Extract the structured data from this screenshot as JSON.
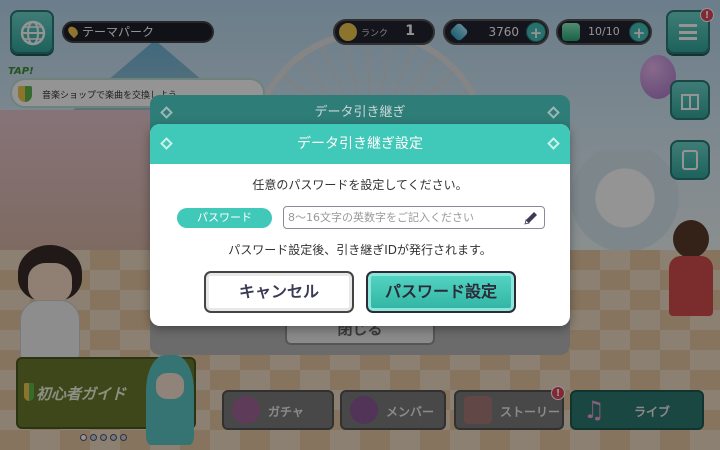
{
  "hud": {
    "location": "テーマパーク",
    "rank_label": "ランク",
    "rank_value": "1",
    "gems": "3760",
    "live_bonus": "10/10",
    "plus": "+",
    "menu_badge": "!"
  },
  "tip": {
    "tap_label": "TAP!",
    "text": "音楽ショップで楽曲を交換しよう"
  },
  "back_dialog": {
    "title": "データ引き継ぎ",
    "close_label": "閉じる"
  },
  "dialog": {
    "title": "データ引き継ぎ設定",
    "message": "任意のパスワードを設定してください。",
    "password_label": "パスワード",
    "password_value": "",
    "password_placeholder": "8〜16文字の英数字をご記入ください",
    "note": "パスワード設定後、引き継ぎIDが発行されます。",
    "cancel_label": "キャンセル",
    "submit_label": "パスワード設定"
  },
  "bottom_nav": {
    "guide_label": "初心者ガイド",
    "gacha_label": "ガチャ",
    "member_label": "メンバー",
    "story_label": "ストーリー",
    "story_badge": "!",
    "live_label": "ライブ",
    "page_dots": 5,
    "active_dot": 0
  },
  "colors": {
    "accent": "#40c8b8",
    "overlay": "rgba(0,0,0,0.42)",
    "badge": "#e2445c"
  }
}
